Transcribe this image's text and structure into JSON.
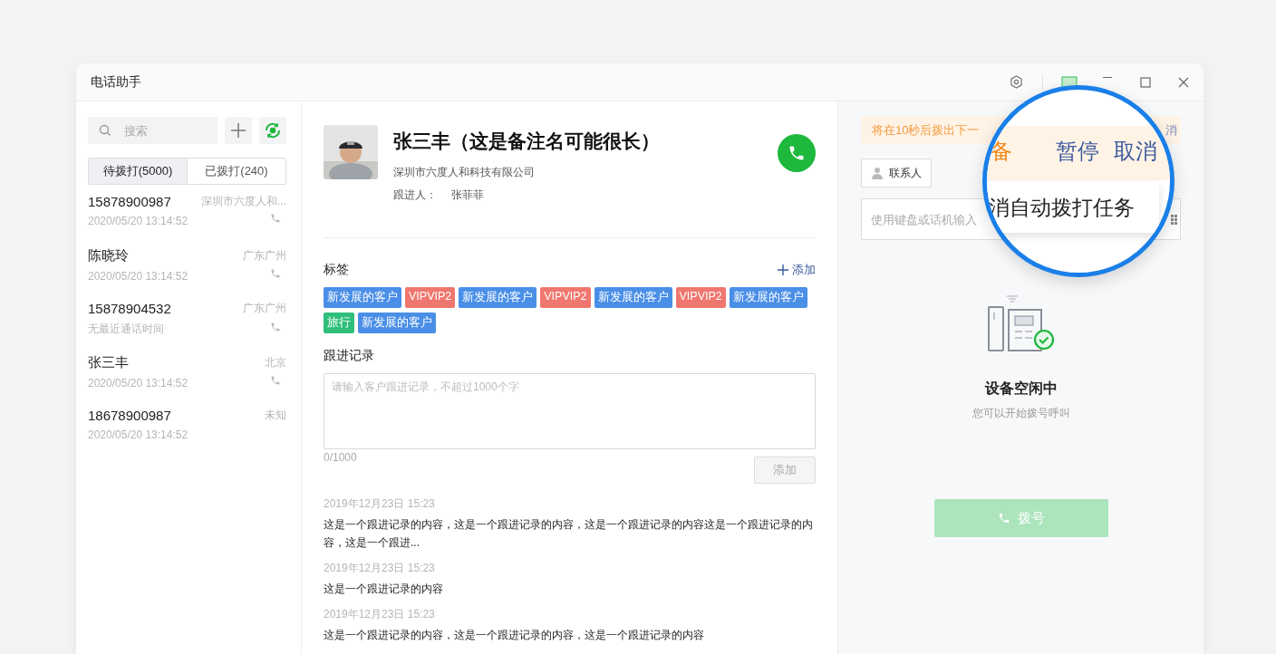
{
  "window": {
    "title": "电话助手"
  },
  "sidebar": {
    "search": {
      "placeholder": "搜索"
    },
    "tabs": [
      {
        "label": "待拨打(5000)",
        "selected": true
      },
      {
        "label": "已拨打(240)",
        "selected": false
      }
    ],
    "contacts": [
      {
        "name": "15878900987",
        "location": "深圳市六度人和...",
        "time": "2020/05/20 13:14:52",
        "phone_icon": true
      },
      {
        "name": "陈晓玲",
        "location": "广东广州",
        "time": "2020/05/20 13:14:52",
        "phone_icon": true
      },
      {
        "name": "15878904532",
        "location": "广东广州",
        "time": "无最近通话时间",
        "phone_icon": true
      },
      {
        "name": "张三丰",
        "location": "北京",
        "time": "2020/05/20 13:14:52",
        "phone_icon": true
      },
      {
        "name": "18678900987",
        "location": "未知",
        "time": "2020/05/20 13:14:52",
        "phone_icon": false
      }
    ]
  },
  "profile": {
    "name": "张三丰（这是备注名可能很长）",
    "company": "深圳市六度人和科技有限公司",
    "owner_label": "跟进人：",
    "owner": "张菲菲"
  },
  "tags": {
    "title": "标签",
    "add_label": "添加",
    "items": [
      {
        "label": "新发展的客户",
        "color": "#4a8fe7"
      },
      {
        "label": "VIPVIP2",
        "color": "#f0776f"
      },
      {
        "label": "新发展的客户",
        "color": "#4a8fe7"
      },
      {
        "label": "VIPVIP2",
        "color": "#f0776f"
      },
      {
        "label": "新发展的客户",
        "color": "#4a8fe7"
      },
      {
        "label": "VIPVIP2",
        "color": "#f0776f"
      },
      {
        "label": "新发展的客户",
        "color": "#4a8fe7"
      },
      {
        "label": "旅行",
        "color": "#2fbf7a"
      },
      {
        "label": "新发展的客户",
        "color": "#4a8fe7"
      }
    ]
  },
  "followup": {
    "title": "跟进记录",
    "placeholder": "请输入客户跟进记录，不超过1000个字",
    "counter": "0/1000",
    "submit": {
      "label": "添加",
      "disabled": true
    },
    "records": [
      {
        "time": "2019年12月23日 15:23",
        "text": "这是一个跟进记录的内容，这是一个跟进记录的内容，这是一个跟进记录的内容这是一个跟进记录的内容，这是一个跟进..."
      },
      {
        "time": "2019年12月23日 15:23",
        "text": "这是一个跟进记录的内容"
      },
      {
        "time": "2019年12月23日 15:23",
        "text": "这是一个跟进记录的内容，这是一个跟进记录的内容，这是一个跟进记录的内容"
      }
    ]
  },
  "dialer": {
    "banner": "将在10秒后拨出下一",
    "banner_tail": "消",
    "contact_button": "联系人",
    "input_placeholder": "使用键盘或话机输入",
    "status_title": "设备空闲中",
    "status_subtitle": "您可以开始拨号呼叫",
    "dial_button": {
      "label": "拨号",
      "disabled": true
    }
  },
  "magnifier": {
    "status_word": "备",
    "pause": "暂停",
    "cancel": "取消",
    "tooltip": "消自动拨打任务"
  }
}
